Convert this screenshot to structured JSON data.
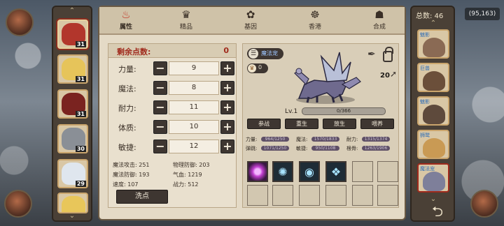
{
  "coords": "(95,163)",
  "tabs": [
    {
      "label": "属性",
      "icon": "fire-icon",
      "active": true
    },
    {
      "label": "精品",
      "icon": "gem-icon"
    },
    {
      "label": "基因",
      "icon": "gene-icon"
    },
    {
      "label": "香港",
      "icon": "pouch-icon"
    },
    {
      "label": "合成",
      "icon": "cauldron-icon"
    }
  ],
  "stats": {
    "points_label": "剩余点数:",
    "points_value": "0",
    "rows": [
      {
        "name": "力量:",
        "value": "9"
      },
      {
        "name": "魔法:",
        "value": "8"
      },
      {
        "name": "耐力:",
        "value": "11"
      },
      {
        "name": "体质:",
        "value": "10"
      },
      {
        "name": "敏捷:",
        "value": "12"
      }
    ],
    "derived": {
      "magic_attack": "魔法攻击: 251",
      "physical_defense": "物理防御: 203",
      "magic_defense": "魔法防御: 193",
      "hp": "气血: 1219",
      "speed": "速度: 107",
      "combat": "战力: 512"
    },
    "reset_label": "洗点"
  },
  "pet": {
    "tag_text": "魔法宠",
    "sub_text": "0",
    "level_up": "20",
    "level": "Lv.1",
    "xp": "0/366",
    "xp_fraction": 0.0,
    "actions": [
      "参战",
      "重生",
      "放生",
      "喂养"
    ],
    "traits": [
      {
        "label": "力量:",
        "bar": "964/1250"
      },
      {
        "label": "魔法:",
        "bar": "1570/1833"
      },
      {
        "label": "耐力:",
        "bar": "1315/1374"
      },
      {
        "label": "弹跳:",
        "bar": "1071/1250"
      },
      {
        "label": "敏捷:",
        "bar": "950/1108"
      },
      {
        "label": "根骨:",
        "bar": "1263/1906"
      }
    ]
  },
  "heroes": [
    {
      "level": "31",
      "color": "#b2362c"
    },
    {
      "level": "31",
      "color": "#e6c45a"
    },
    {
      "level": "31",
      "color": "#7a2320"
    },
    {
      "level": "30",
      "color": "#8a8f96"
    },
    {
      "level": "29",
      "color": "#dfe6ee"
    },
    {
      "level": "",
      "color": "#e8c65a"
    }
  ],
  "right_panel": {
    "total_label": "总数: 46",
    "pets": [
      {
        "name": "魅影",
        "color": "#8a6a54"
      },
      {
        "name": "巨兽",
        "color": "#6b4f3a"
      },
      {
        "name": "魅影",
        "color": "#5e4a3c"
      },
      {
        "name": "狮鹫",
        "color": "#c99a54"
      },
      {
        "name": "魔法宠",
        "color": "#7e7f9a"
      }
    ]
  }
}
